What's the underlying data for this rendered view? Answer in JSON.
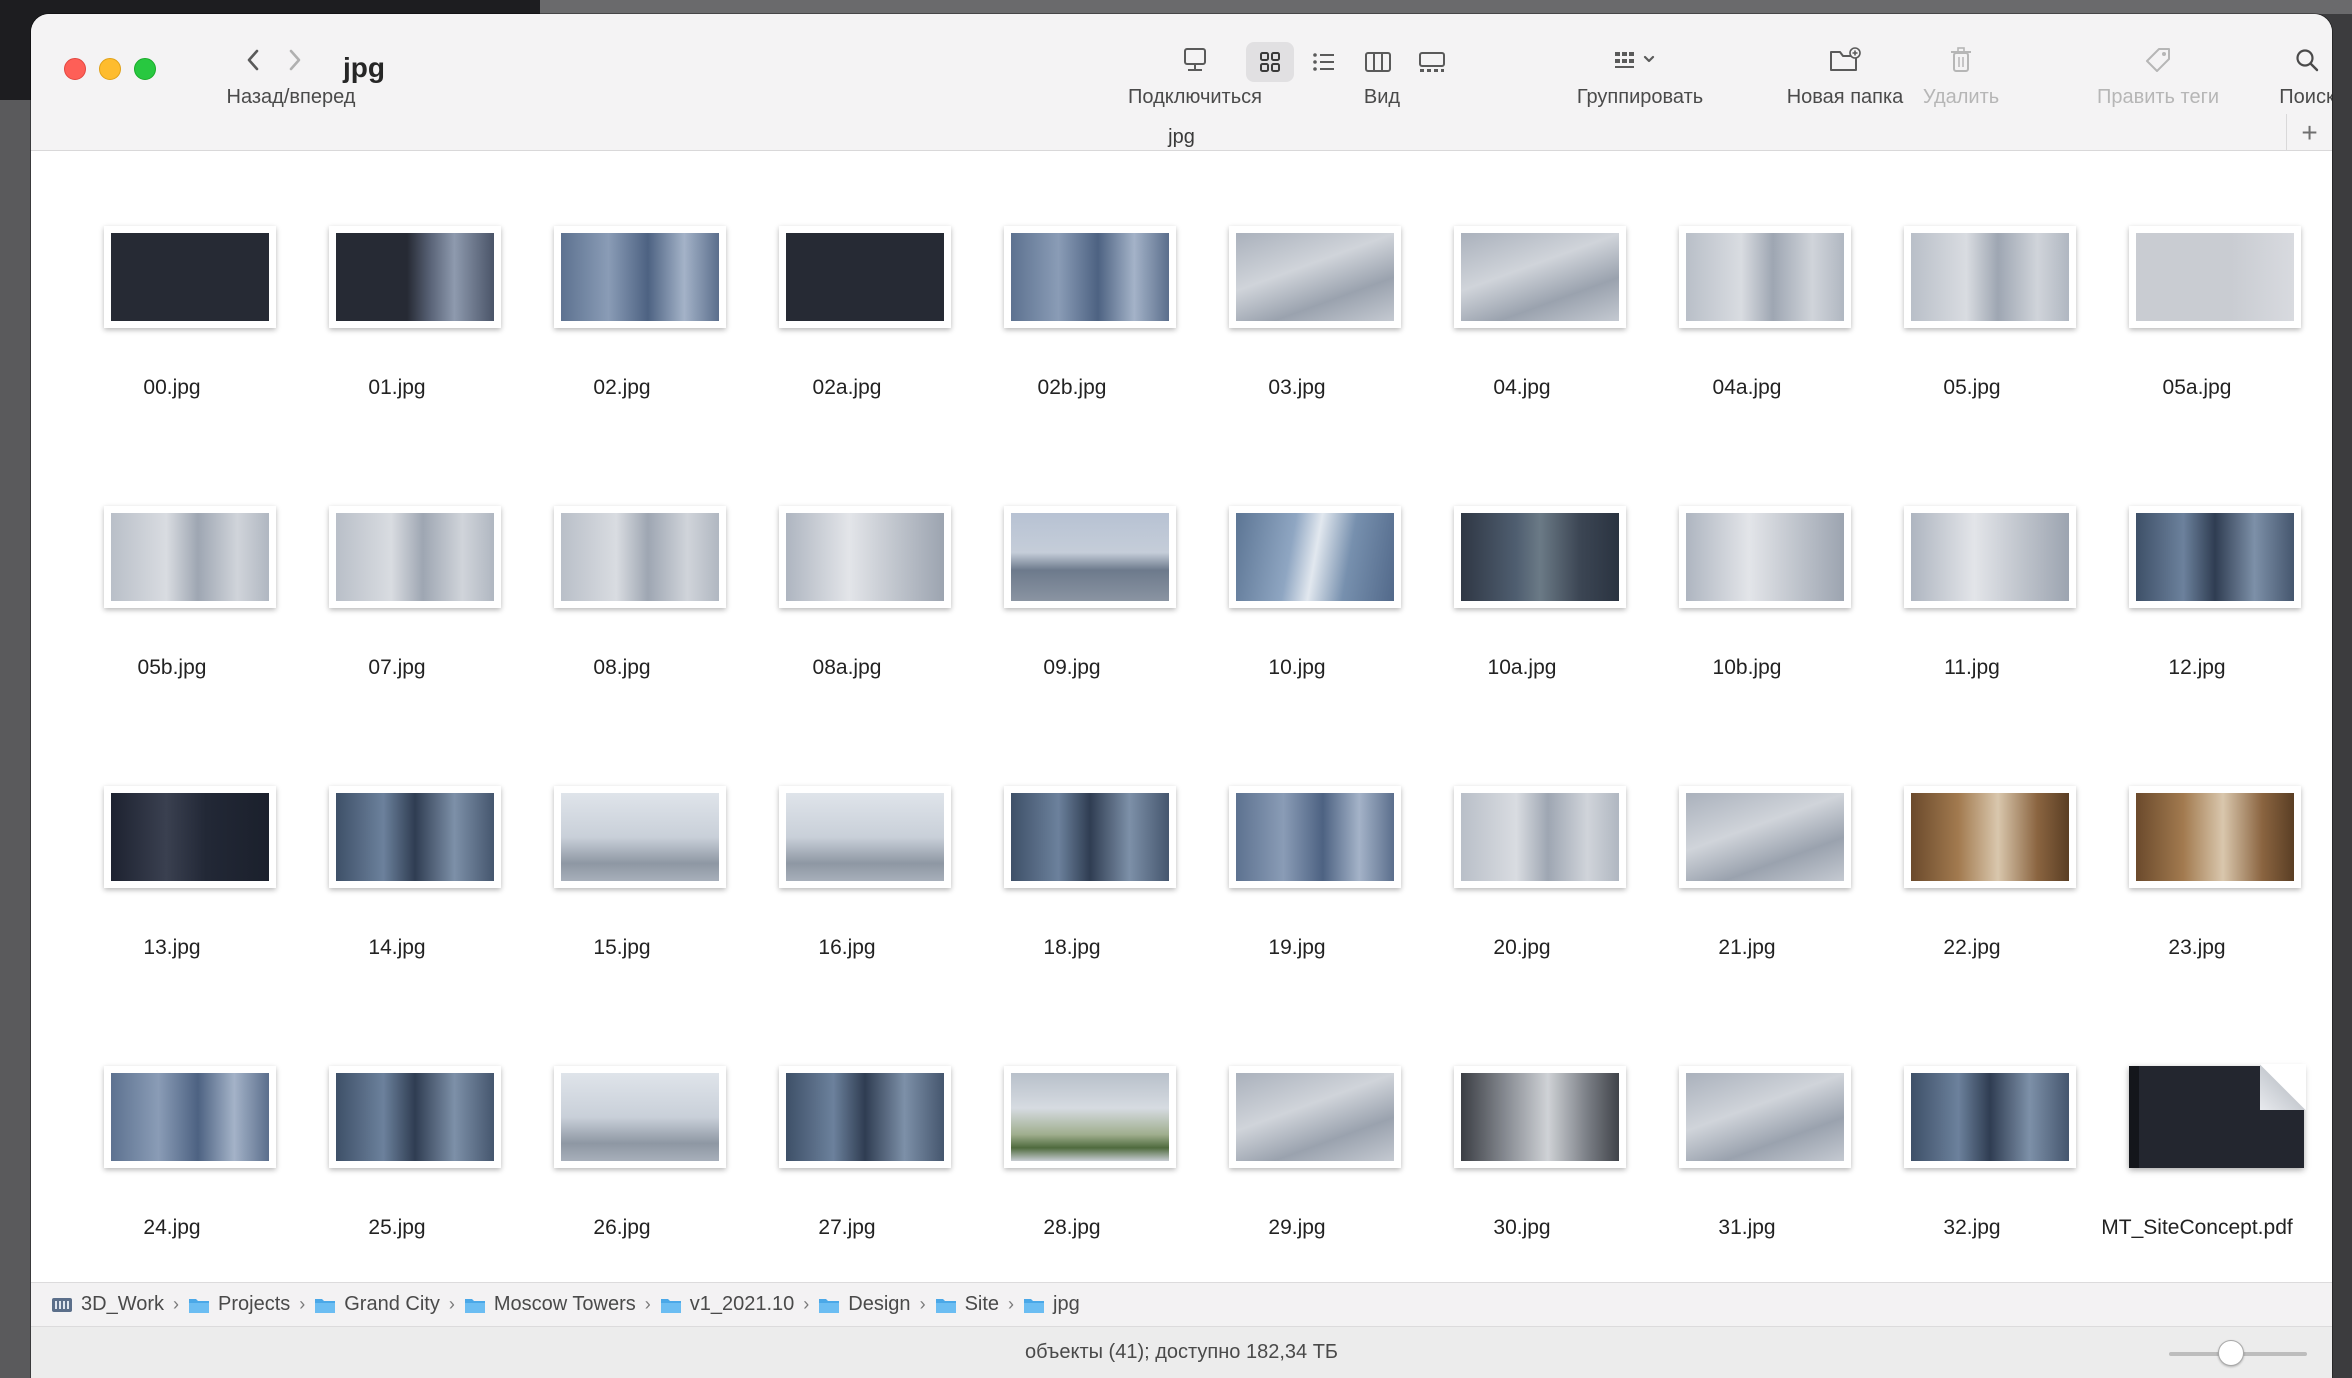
{
  "window": {
    "title": "jpg",
    "nav_label": "Назад/вперед",
    "tab_title": "jpg",
    "tab_add": "+"
  },
  "toolbar": {
    "connect": "Подключиться",
    "view": "Вид",
    "group": "Группировать",
    "new_folder": "Новая папка",
    "delete": "Удалить",
    "edit_tags": "Править теги",
    "search": "Поиск"
  },
  "files": [
    {
      "name": "00.jpg",
      "thumb": "dark-title"
    },
    {
      "name": "01.jpg",
      "thumb": "dark-towers"
    },
    {
      "name": "02.jpg",
      "thumb": "blue-towers"
    },
    {
      "name": "02a.jpg",
      "thumb": "dark-menu"
    },
    {
      "name": "02b.jpg",
      "thumb": "blue-towers"
    },
    {
      "name": "03.jpg",
      "thumb": "grey-city"
    },
    {
      "name": "04.jpg",
      "thumb": "grey-city"
    },
    {
      "name": "04a.jpg",
      "thumb": "grey-towers"
    },
    {
      "name": "05.jpg",
      "thumb": "grey-towers"
    },
    {
      "name": "05a.jpg",
      "thumb": "light-chart"
    },
    {
      "name": "05b.jpg",
      "thumb": "grey-towers"
    },
    {
      "name": "07.jpg",
      "thumb": "grey-towers"
    },
    {
      "name": "08.jpg",
      "thumb": "grey-towers"
    },
    {
      "name": "08a.jpg",
      "thumb": "grey-round"
    },
    {
      "name": "09.jpg",
      "thumb": "sky-view"
    },
    {
      "name": "10.jpg",
      "thumb": "blue-tower"
    },
    {
      "name": "10a.jpg",
      "thumb": "dark-aerial"
    },
    {
      "name": "10b.jpg",
      "thumb": "grey-round"
    },
    {
      "name": "11.jpg",
      "thumb": "grey-round"
    },
    {
      "name": "12.jpg",
      "thumb": "blue-interior"
    },
    {
      "name": "13.jpg",
      "thumb": "dark-person"
    },
    {
      "name": "14.jpg",
      "thumb": "blue-interior"
    },
    {
      "name": "15.jpg",
      "thumb": "light-interior"
    },
    {
      "name": "16.jpg",
      "thumb": "light-interior"
    },
    {
      "name": "18.jpg",
      "thumb": "blue-interior"
    },
    {
      "name": "19.jpg",
      "thumb": "blue-towers"
    },
    {
      "name": "20.jpg",
      "thumb": "grey-towers"
    },
    {
      "name": "21.jpg",
      "thumb": "grey-city"
    },
    {
      "name": "22.jpg",
      "thumb": "warm-lobby"
    },
    {
      "name": "23.jpg",
      "thumb": "warm-lobby"
    },
    {
      "name": "24.jpg",
      "thumb": "blue-towers"
    },
    {
      "name": "25.jpg",
      "thumb": "blue-interior"
    },
    {
      "name": "26.jpg",
      "thumb": "light-interior"
    },
    {
      "name": "27.jpg",
      "thumb": "blue-interior"
    },
    {
      "name": "28.jpg",
      "thumb": "green-terrace"
    },
    {
      "name": "29.jpg",
      "thumb": "grey-city"
    },
    {
      "name": "30.jpg",
      "thumb": "grey-hall"
    },
    {
      "name": "31.jpg",
      "thumb": "grey-city"
    },
    {
      "name": "32.jpg",
      "thumb": "blue-interior"
    }
  ],
  "pdf_file": {
    "name": "MT_SiteConcept.pdf"
  },
  "breadcrumb": [
    "3D_Work",
    "Projects",
    "Grand City",
    "Moscow Towers",
    "v1_2021.10",
    "Design",
    "Site",
    "jpg"
  ],
  "status": {
    "text": "объекты (41); доступно 182,34 ТБ",
    "icon_size_level": 0.45
  },
  "colors": {
    "folder": "#4aa8e8",
    "drive": "#5b6f8a"
  }
}
